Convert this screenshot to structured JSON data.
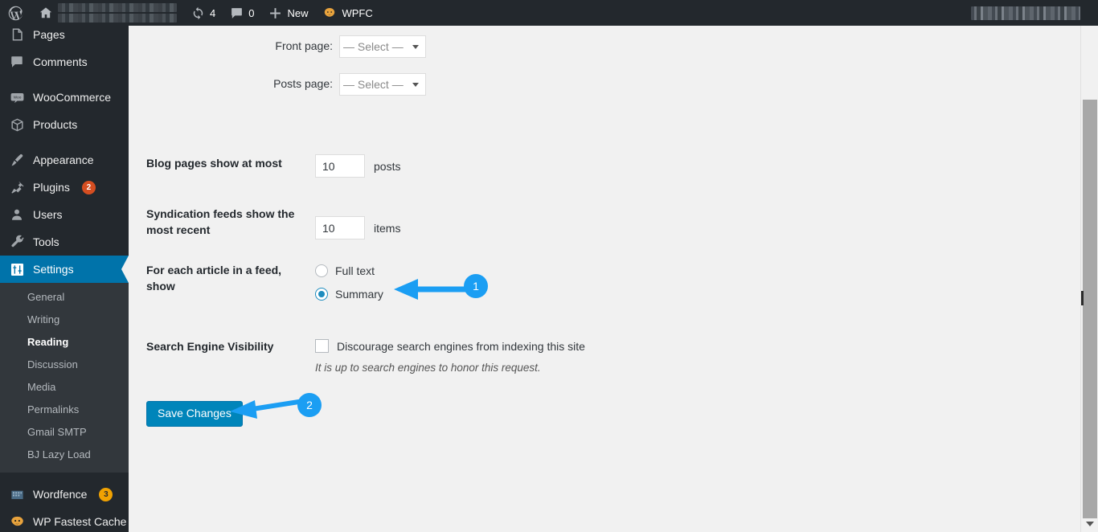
{
  "adminbar": {
    "wp_logo_icon": "wordpress-logo-icon",
    "home_icon": "home-icon",
    "site_name_redacted": "",
    "updates": {
      "icon": "updates-refresh-icon",
      "count": "4"
    },
    "comments": {
      "icon": "comment-bubble-icon",
      "count": "0"
    },
    "new": {
      "icon": "plus-icon",
      "label": "New"
    },
    "wpfc": {
      "icon": "wp-fastest-cache-icon",
      "label": "WPFC"
    },
    "account_redacted": ""
  },
  "sidebar": {
    "items": [
      {
        "label": "Pages",
        "icon": "pages-icon",
        "badge": "",
        "current": false
      },
      {
        "label": "Comments",
        "icon": "comments-icon",
        "badge": "",
        "current": false
      },
      {
        "label": "WooCommerce",
        "icon": "woocommerce-icon",
        "badge": "",
        "current": false
      },
      {
        "label": "Products",
        "icon": "products-box-icon",
        "badge": "",
        "current": false
      },
      {
        "label": "Appearance",
        "icon": "appearance-brush-icon",
        "badge": "",
        "current": false
      },
      {
        "label": "Plugins",
        "icon": "plugins-plug-icon",
        "badge": "2",
        "current": false
      },
      {
        "label": "Users",
        "icon": "users-person-icon",
        "badge": "",
        "current": false
      },
      {
        "label": "Tools",
        "icon": "tools-wrench-icon",
        "badge": "",
        "current": false
      },
      {
        "label": "Settings",
        "icon": "settings-sliders-icon",
        "badge": "",
        "current": true
      }
    ],
    "submenu": [
      {
        "label": "General",
        "current": false
      },
      {
        "label": "Writing",
        "current": false
      },
      {
        "label": "Reading",
        "current": true
      },
      {
        "label": "Discussion",
        "current": false
      },
      {
        "label": "Media",
        "current": false
      },
      {
        "label": "Permalinks",
        "current": false
      },
      {
        "label": "Gmail SMTP",
        "current": false
      },
      {
        "label": "BJ Lazy Load",
        "current": false
      }
    ],
    "plugins_bottom": [
      {
        "label": "Wordfence",
        "icon": "wordfence-icon",
        "badge": "3"
      },
      {
        "label": "WP Fastest Cache",
        "icon": "wp-fastest-cache-icon",
        "badge": ""
      }
    ]
  },
  "main": {
    "front_page": {
      "label": "Front page:",
      "value": "— Select —"
    },
    "posts_page": {
      "label": "Posts page:",
      "value": "— Select —"
    },
    "blog_pages": {
      "label": "Blog pages show at most",
      "value": "10",
      "unit": "posts"
    },
    "syndication": {
      "label": "Syndication feeds show the most recent",
      "value": "10",
      "unit": "items"
    },
    "feed_show": {
      "label": "For each article in a feed, show",
      "options": [
        {
          "label": "Full text",
          "checked": false
        },
        {
          "label": "Summary",
          "checked": true
        }
      ]
    },
    "search_visibility": {
      "label": "Search Engine Visibility",
      "checkbox_label": "Discourage search engines from indexing this site",
      "checked": false,
      "hint": "It is up to search engines to honor this request."
    },
    "save_button": "Save Changes"
  },
  "annotations": [
    {
      "number": "1",
      "target": "summary-radio"
    },
    {
      "number": "2",
      "target": "save-changes-button"
    }
  ],
  "colors": {
    "admin_dark": "#23282d",
    "submenu_dark": "#32373c",
    "accent_blue": "#0073aa",
    "button_blue": "#0085ba",
    "annotation_blue": "#1b9ef3",
    "badge_red": "#d54e21",
    "badge_amber": "#f0a202",
    "content_bg": "#f1f1f1"
  }
}
